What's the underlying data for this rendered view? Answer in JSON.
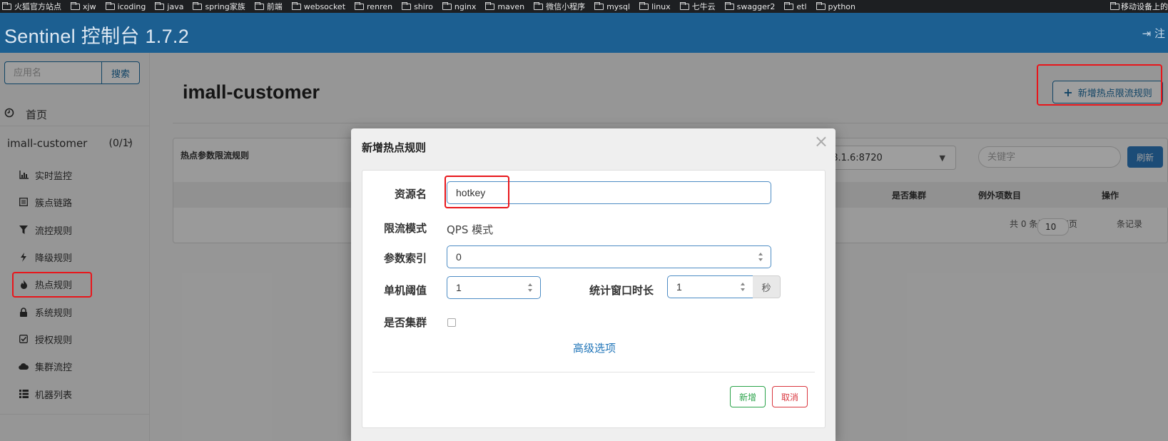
{
  "bookmarks": [
    {
      "label": "火狐官方站点"
    },
    {
      "label": "xjw"
    },
    {
      "label": "icoding"
    },
    {
      "label": "java"
    },
    {
      "label": "spring家族"
    },
    {
      "label": "前端"
    },
    {
      "label": "websocket"
    },
    {
      "label": "renren"
    },
    {
      "label": "shiro"
    },
    {
      "label": "nginx"
    },
    {
      "label": "maven"
    },
    {
      "label": "微信小程序"
    },
    {
      "label": "mysql"
    },
    {
      "label": "linux"
    },
    {
      "label": "七牛云"
    },
    {
      "label": "swagger2"
    },
    {
      "label": "etl"
    },
    {
      "label": "python"
    }
  ],
  "bookmarks_right": "移动设备上的",
  "header": {
    "brand": "Sentinel 控制台 1.7.2",
    "logout_label": "注"
  },
  "sidebar": {
    "search_placeholder": "应用名",
    "search_button": "搜索",
    "home_label": "首页",
    "app_name": "imall-customer",
    "app_count": "(0/1)",
    "menu": [
      {
        "label": "实时监控",
        "icon": "bar-chart-icon"
      },
      {
        "label": "簇点链路",
        "icon": "list-icon"
      },
      {
        "label": "流控规则",
        "icon": "filter-icon"
      },
      {
        "label": "降级规则",
        "icon": "flash-icon"
      },
      {
        "label": "热点规则",
        "icon": "fire-icon"
      },
      {
        "label": "系统规则",
        "icon": "lock-icon"
      },
      {
        "label": "授权规则",
        "icon": "check-icon"
      },
      {
        "label": "集群流控",
        "icon": "cloud-icon"
      },
      {
        "label": "机器列表",
        "icon": "th-list-icon"
      }
    ]
  },
  "main": {
    "page_title": "imall-customer",
    "add_rule_button": "新增热点限流规则",
    "panel_title": "热点参数限流规则",
    "machine_select_value": "92.168.1.6:8720",
    "keyword_placeholder": "关键字",
    "refresh_button": "刷新",
    "table_headers": [
      "是否集群",
      "例外项数目",
      "操作"
    ],
    "pager_prefix": "共 0 条记录, 每页",
    "page_size": "10",
    "pager_suffix": "条记录"
  },
  "modal": {
    "title": "新增热点规则",
    "close_symbol": "×",
    "resource_label": "资源名",
    "resource_value": "hotkey",
    "mode_label": "限流模式",
    "mode_value": "QPS 模式",
    "param_index_label": "参数索引",
    "param_index_value": "0",
    "threshold_label": "单机阈值",
    "threshold_value": "1",
    "window_label": "统计窗口时长",
    "window_value": "1",
    "window_unit": "秒",
    "cluster_label": "是否集群",
    "cluster_checked": false,
    "advanced_link": "高级选项",
    "ok_button": "新增",
    "cancel_button": "取消"
  },
  "colors": {
    "header_bg": "#1c5f91",
    "accent": "#1c6ea4",
    "annotation_red": "#e8161b",
    "ok_green": "#2ba34a",
    "cancel_red": "#d9363e"
  }
}
